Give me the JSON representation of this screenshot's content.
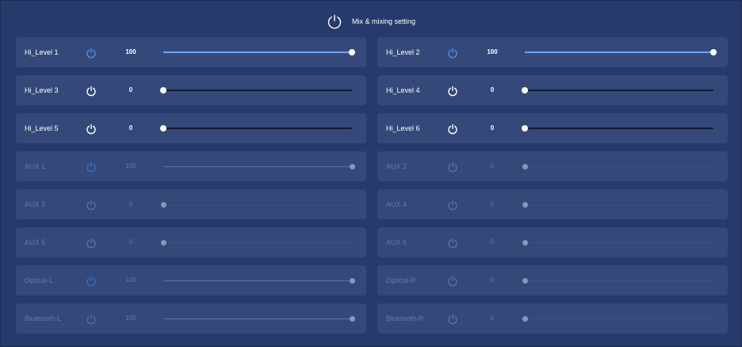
{
  "header": {
    "title": "Mix & mixing setting"
  },
  "colors": {
    "background": "#263b6b",
    "card": "#34497a",
    "accent_blue": "#4a90e2",
    "disabled_text": "#6879a3"
  },
  "channels": [
    {
      "label": "Hi_Level 1",
      "value": "100",
      "level": 1.0,
      "power_on": true,
      "enabled": true
    },
    {
      "label": "Hi_Level 2",
      "value": "100",
      "level": 1.0,
      "power_on": true,
      "enabled": true
    },
    {
      "label": "Hi_Level 3",
      "value": "0",
      "level": 0.0,
      "power_on": false,
      "enabled": true
    },
    {
      "label": "Hi_Level 4",
      "value": "0",
      "level": 0.0,
      "power_on": false,
      "enabled": true
    },
    {
      "label": "Hi_Level 5",
      "value": "0",
      "level": 0.0,
      "power_on": false,
      "enabled": true
    },
    {
      "label": "Hi_Level 6",
      "value": "0",
      "level": 0.0,
      "power_on": false,
      "enabled": true
    },
    {
      "label": "AUX 1",
      "value": "100",
      "level": 1.0,
      "power_on": true,
      "enabled": false
    },
    {
      "label": "AUX 2",
      "value": "0",
      "level": 0.0,
      "power_on": false,
      "enabled": false
    },
    {
      "label": "AUX 3",
      "value": "0",
      "level": 0.0,
      "power_on": false,
      "enabled": false
    },
    {
      "label": "AUX 4",
      "value": "0",
      "level": 0.0,
      "power_on": false,
      "enabled": false
    },
    {
      "label": "AUX 5",
      "value": "0",
      "level": 0.0,
      "power_on": false,
      "enabled": false
    },
    {
      "label": "AUX 6",
      "value": "0",
      "level": 0.0,
      "power_on": false,
      "enabled": false
    },
    {
      "label": "Optical-L",
      "value": "100",
      "level": 1.0,
      "power_on": true,
      "enabled": false
    },
    {
      "label": "Optical-R",
      "value": "0",
      "level": 0.0,
      "power_on": false,
      "enabled": false
    },
    {
      "label": "Bluetooth-L",
      "value": "100",
      "level": 1.0,
      "power_on": true,
      "enabled": false
    },
    {
      "label": "Bluetooth-R",
      "value": "0",
      "level": 0.0,
      "power_on": false,
      "enabled": false
    }
  ]
}
